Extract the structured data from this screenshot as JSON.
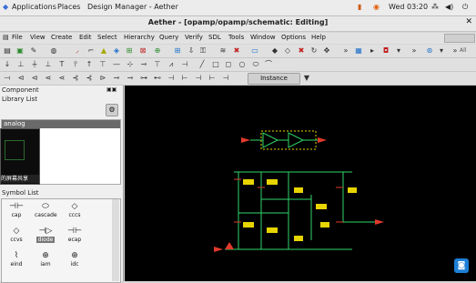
{
  "top_bar": {
    "applications": "Applications",
    "places": "Places",
    "active_app": "Design Manager - Aether",
    "clock": "Wed 03:20"
  },
  "window": {
    "title": "Aether - [opamp/opamp/schematic: Editing]"
  },
  "menu": [
    "File",
    "View",
    "Create",
    "Edit",
    "Select",
    "Hierarchy",
    "Query",
    "Verify",
    "SDL",
    "Tools",
    "Window",
    "Options",
    "Help"
  ],
  "toolbar3": {
    "instance_label": "Instance"
  },
  "left_panel": {
    "component_title": "Component",
    "library_list_title": "Library List",
    "library_selected": "analog",
    "thumbnail_caption": "的屏幕共享",
    "symbol_list_title": "Symbol List",
    "symbols": [
      "cap",
      "cascade",
      "cccs",
      "ccvs",
      "diode",
      "ecap",
      "eind",
      "iam",
      "idc"
    ]
  },
  "toolbar2": {
    "scale_label": "All"
  },
  "colors": {
    "canvas_bg": "#000000",
    "wire_green": "#2fd66a",
    "instance_red": "#e03a2c",
    "label_yellow": "#e8d400",
    "selection_blue": "#1d4fd6"
  }
}
